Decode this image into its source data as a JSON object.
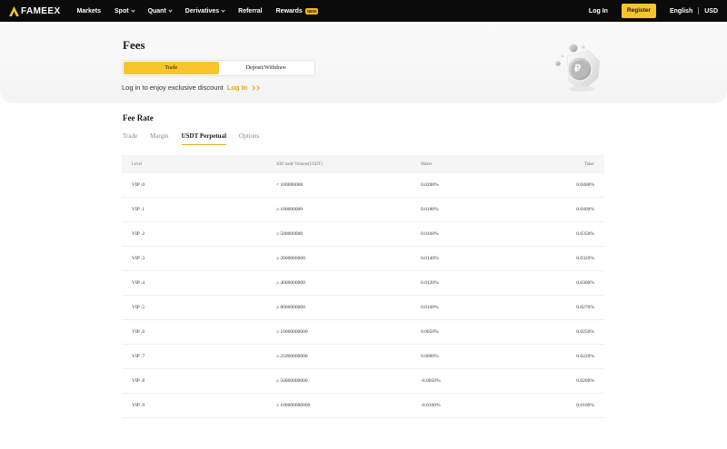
{
  "nav": {
    "brand": "FAMEEX",
    "items": [
      {
        "label": "Markets",
        "has_menu": false
      },
      {
        "label": "Spot",
        "has_menu": true
      },
      {
        "label": "Quant",
        "has_menu": true
      },
      {
        "label": "Derivatives",
        "has_menu": true
      },
      {
        "label": "Referral",
        "has_menu": false
      },
      {
        "label": "Rewards",
        "has_menu": false,
        "badge": "NEW"
      }
    ],
    "login": "Log In",
    "register": "Register",
    "language": "English",
    "currency": "USD",
    "accent": "#f7c52b"
  },
  "hero": {
    "title": "Fees",
    "segments": [
      {
        "label": "Trade",
        "active": true
      },
      {
        "label": "Deposit/Withdraw",
        "active": false
      }
    ],
    "discount_text": "Log in to enjoy exclusive discount",
    "login_link": "Log In",
    "coin_symbol": "₽"
  },
  "fee_rate": {
    "title": "Fee Rate",
    "tabs": [
      {
        "label": "Trade",
        "active": false
      },
      {
        "label": "Margin",
        "active": false
      },
      {
        "label": "USDT Perpetual",
        "active": true
      },
      {
        "label": "Options",
        "active": false
      }
    ],
    "columns": [
      "Level",
      "30D trade Volume(USDT)",
      "Maker",
      "Taker"
    ],
    "rows": [
      [
        "VIP .0",
        "< 100000000",
        "0.0200%",
        "0.0400%"
      ],
      [
        "VIP .1",
        "≥ 100000000",
        "0.0180%",
        "0.0400%"
      ],
      [
        "VIP .2",
        "≥ 500000000",
        "0.0160%",
        "0.0350%"
      ],
      [
        "VIP .3",
        "≥ 2000000000",
        "0.0140%",
        "0.0320%"
      ],
      [
        "VIP .4",
        "≥ 4000000000",
        "0.0120%",
        "0.0300%"
      ],
      [
        "VIP .5",
        "≥ 8000000000",
        "0.0100%",
        "0.0270%"
      ],
      [
        "VIP .6",
        "≥ 10000000000",
        "0.0050%",
        "0.0250%"
      ],
      [
        "VIP .7",
        "≥ 25000000000",
        "0.0000%",
        "0.0220%"
      ],
      [
        "VIP .8",
        "≥ 50000000000",
        "-0.0050%",
        "0.0200%"
      ],
      [
        "VIP .9",
        "≥ 100000000000",
        "-0.0100%",
        "0.0100%"
      ]
    ]
  }
}
